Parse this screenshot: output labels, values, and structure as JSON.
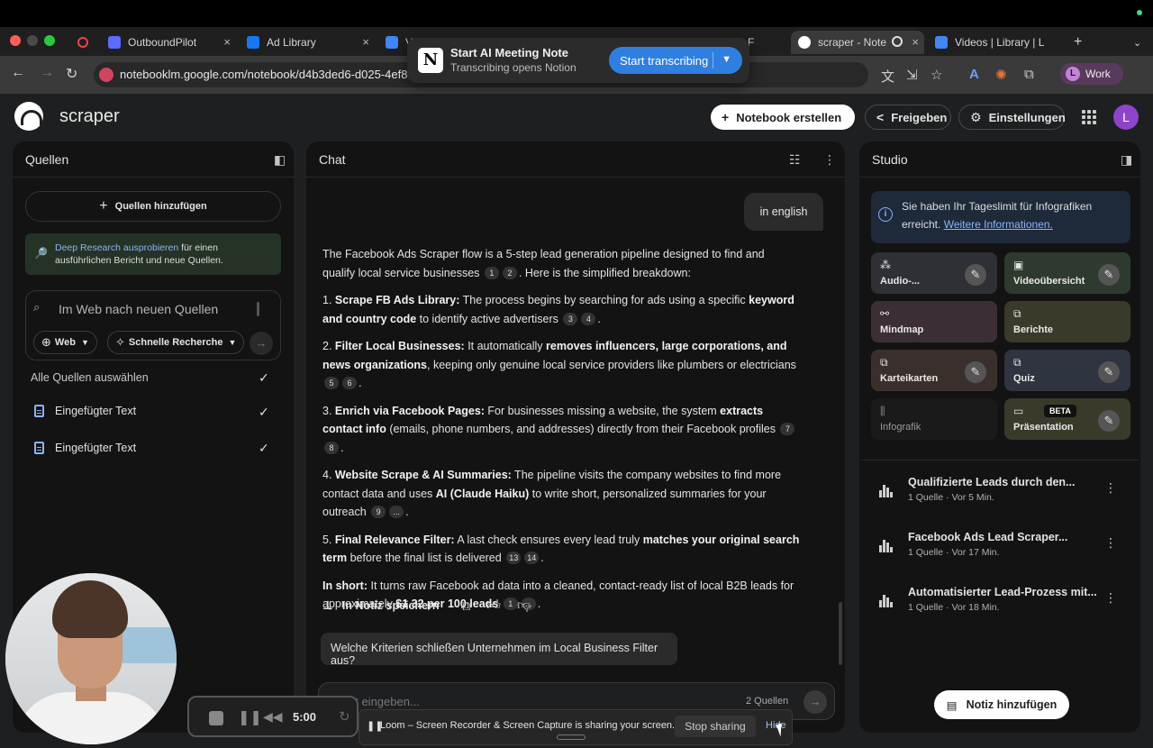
{
  "browser": {
    "tabs": [
      {
        "title": "OutboundPilot",
        "color": "#5b6cff"
      },
      {
        "title": "Ad Library",
        "color": "#1877f2"
      },
      {
        "title": "Vi",
        "color": "#4285f4"
      },
      {
        "title": "ur F",
        "color": "#777777"
      },
      {
        "title": "scraper - Note",
        "color": "#ffffff"
      },
      {
        "title": "Videos | Library | L",
        "color": "#4285f4"
      }
    ],
    "url": "notebooklm.google.com/notebook/d4b3ded6-d025-4ef8",
    "profile_initial": "L",
    "profile_label": "Work"
  },
  "notion_popup": {
    "title": "Start AI Meeting Note",
    "subtitle": "Transcribing opens Notion",
    "button": "Start transcribing"
  },
  "header": {
    "app_title": "scraper",
    "create_notebook": "Notebook erstellen",
    "share": "Freigeben",
    "settings": "Einstellungen",
    "avatar_initial": "L"
  },
  "sources": {
    "title": "Quellen",
    "add_sources": "Quellen hinzufügen",
    "deep_research_link": "Deep Research ausprobieren",
    "deep_research_text1": " für einen",
    "deep_research_text2": "ausführlichen Bericht und neue Quellen.",
    "search_placeholder": "Im Web nach neuen Quellen",
    "chip_web": "Web",
    "chip_research": "Schnelle Recherche",
    "select_all": "Alle Quellen auswählen",
    "items": [
      {
        "label": "Eingefügter Text"
      },
      {
        "label": "Eingefügter Text"
      }
    ]
  },
  "chat": {
    "title": "Chat",
    "user_message": "in english",
    "intro": "The Facebook Ads Scraper flow is a 5-step lead generation pipeline designed to find and qualify local service businesses",
    "intro_tail": ". Here is the simplified breakdown:",
    "steps": [
      {
        "num": "1. ",
        "head": "Scrape FB Ads Library:",
        "t1": " The process begins by searching for ads using a specific ",
        "b1": "keyword and country code",
        "t2": " to identify active advertisers",
        "t3": "",
        "b2": "",
        "t4": "",
        "cites": [
          "3",
          "4"
        ]
      },
      {
        "num": "2. ",
        "head": "Filter Local Businesses:",
        "t1": " It automatically ",
        "b1": "removes influencers, large corporations, and news organizations",
        "t2": ", keeping only genuine local service providers like plumbers or electricians",
        "t3": "",
        "b2": "",
        "t4": "",
        "cites": [
          "5",
          "6"
        ]
      },
      {
        "num": "3. ",
        "head": "Enrich via Facebook Pages:",
        "t1": " For businesses missing a website, the system ",
        "b1": "extracts contact info",
        "t2": " (emails, phone numbers, and addresses) directly from their Facebook profiles",
        "t3": "",
        "b2": "",
        "t4": "",
        "cites": [
          "7",
          "8"
        ]
      },
      {
        "num": "4. ",
        "head": "Website Scrape & AI Summaries:",
        "t1": " The pipeline visits the company websites to find more contact data and uses ",
        "b1": "AI (Claude Haiku)",
        "t2": " to write short, personalized summaries for your outreach",
        "t3": "",
        "b2": "",
        "t4": "",
        "cites": [
          "9",
          "..."
        ]
      },
      {
        "num": "5. ",
        "head": "Final Relevance Filter:",
        "t1": " A last check ensures every lead truly ",
        "b1": "matches your original search term",
        "t2": " before the final list is delivered",
        "t3": "",
        "b2": "",
        "t4": "",
        "cites": [
          "13",
          "14"
        ]
      }
    ],
    "intro_cites": [
      "1",
      "2"
    ],
    "short_head": "In short:",
    "short_text": " It turns raw Facebook ad data into a cleaned, contact-ready list of local B2B leads for approximately ",
    "short_bold": "$1.32 per 100 leads",
    "short_cites": [
      "1",
      "..."
    ],
    "save_note": "In Notiz speichern",
    "suggestion": "Welche Kriterien schließen Unternehmen im Local Business Filter aus?",
    "input_placeholder": "Text eingeben...",
    "source_count": "2 Quellen"
  },
  "studio": {
    "title": "Studio",
    "limit_text": "Sie haben Ihr Tageslimit für Infografiken erreicht.",
    "limit_link": "Weitere Informationen.",
    "tiles": [
      {
        "label": "Audio-...",
        "icon": "audio-icon",
        "glyph": "⁂",
        "bg": "#2f3035",
        "edit": true
      },
      {
        "label": "Videoübersicht",
        "icon": "video-icon",
        "glyph": "▣",
        "bg": "#2f3a2f",
        "edit": true
      },
      {
        "label": "Mindmap",
        "icon": "mindmap-icon",
        "glyph": "⚯",
        "bg": "#3b2f35",
        "edit": false
      },
      {
        "label": "Berichte",
        "icon": "report-icon",
        "glyph": "⧉",
        "bg": "#393a2a",
        "edit": false
      },
      {
        "label": "Karteikarten",
        "icon": "flashcards-icon",
        "glyph": "⧉",
        "bg": "#3a302b",
        "edit": true
      },
      {
        "label": "Quiz",
        "icon": "quiz-icon",
        "glyph": "⧉",
        "bg": "#2e3440",
        "edit": true
      },
      {
        "label": "Infografik",
        "icon": "infographic-icon",
        "glyph": "⫼",
        "bg": "#1a1a1b",
        "edit": false
      },
      {
        "label": "Präsentation",
        "icon": "presentation-icon",
        "glyph": "▭",
        "bg": "#393a2a",
        "edit": true,
        "badge": "BETA"
      }
    ],
    "notes": [
      {
        "title": "Qualifizierte Leads durch den...",
        "meta": "1 Quelle · Vor 5 Min."
      },
      {
        "title": "Facebook Ads Lead Scraper...",
        "meta": "1 Quelle · Vor 17 Min."
      },
      {
        "title": "Automatisierter Lead-Prozess mit...",
        "meta": "1 Quelle · Vor 18 Min."
      }
    ],
    "add_note": "Notiz hinzufügen"
  },
  "loom": {
    "time": "5:00",
    "message": "Loom – Screen Recorder & Screen Capture is sharing your screen.",
    "stop": "Stop sharing",
    "hide": "Hide"
  }
}
